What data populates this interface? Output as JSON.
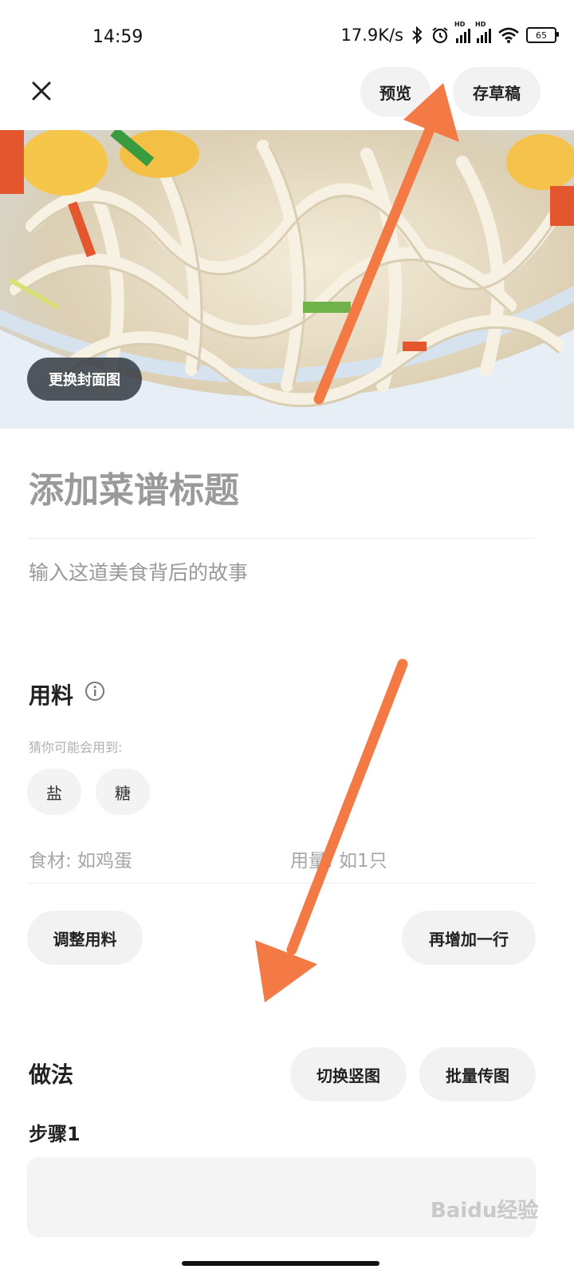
{
  "status_bar": {
    "time": "14:59",
    "network_speed": "17.9K/s",
    "battery": "65",
    "sig_hd_1": "HD",
    "sig_hd_2": "HD"
  },
  "header": {
    "close_icon": "close-icon",
    "preview_label": "预览",
    "save_draft_label": "存草稿"
  },
  "cover": {
    "change_cover_label": "更换封面图"
  },
  "recipe": {
    "title_placeholder": "添加菜谱标题",
    "story_placeholder": "输入这道美食背后的故事"
  },
  "ingredients": {
    "section_title": "用料",
    "hint": "猜你可能会用到:",
    "suggestions": [
      "盐",
      "糖"
    ],
    "ingredient_placeholder": "食材: 如鸡蛋",
    "amount_placeholder": "用量: 如1只",
    "adjust_label": "调整用料",
    "add_row_label": "再增加一行"
  },
  "steps": {
    "section_title": "做法",
    "switch_vertical_label": "切换竖图",
    "batch_upload_label": "批量传图",
    "step1_title": "步骤1"
  },
  "watermark": "Baidu经验",
  "colors": {
    "arrow": "#f47a45",
    "chip_bg": "#f2f2f2",
    "cover_button_bg": "#3a434c"
  }
}
